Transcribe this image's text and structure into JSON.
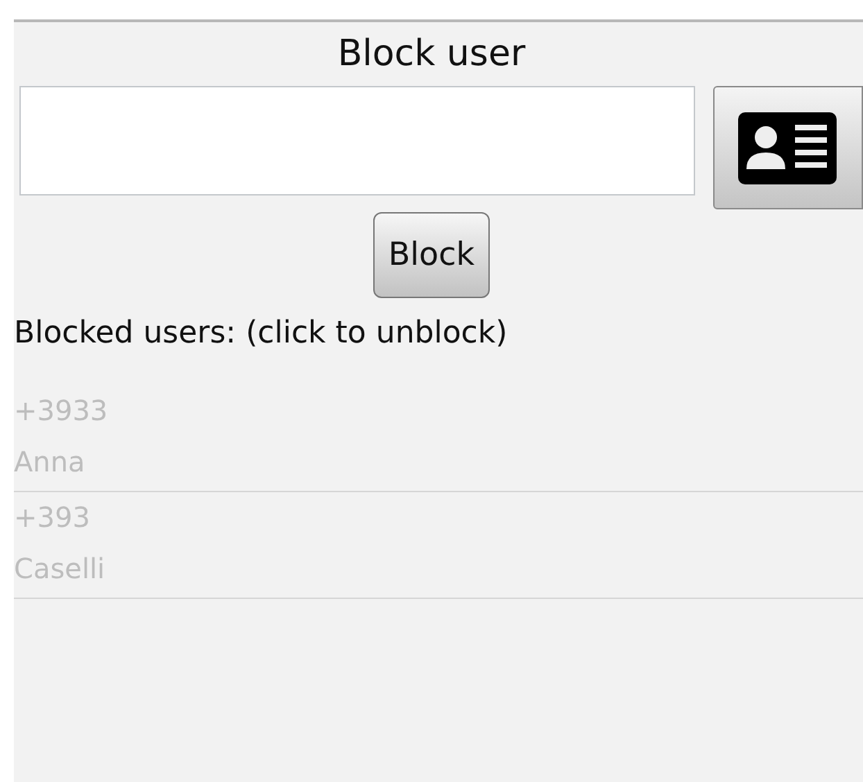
{
  "title": "Block user",
  "block_button": "Block",
  "list_label": "Blocked users: (click to unblock)",
  "blocked_users": [
    {
      "number": "+3933",
      "name": "Anna"
    },
    {
      "number": "+393",
      "name": "Caselli"
    }
  ]
}
